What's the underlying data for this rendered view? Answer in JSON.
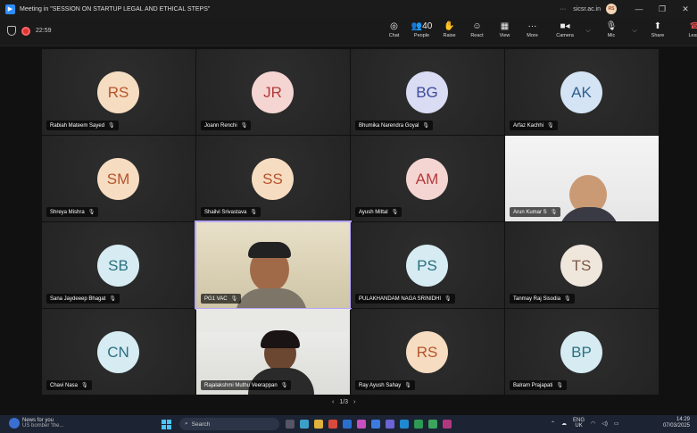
{
  "window": {
    "title": "Meeting in \"SESSION ON STARTUP LEGAL AND ETHICAL STEPS\"",
    "more": "···",
    "domain": "sicsr.ac.in",
    "user_initials": "RS",
    "minimize": "—",
    "restore": "❐",
    "close": "✕"
  },
  "toolbar": {
    "timer": "22:59",
    "items": [
      {
        "icon": "◎",
        "label": "Chat"
      },
      {
        "icon": "👥40",
        "label": "People"
      },
      {
        "icon": "✋",
        "label": "Raise"
      },
      {
        "icon": "☺",
        "label": "React"
      },
      {
        "icon": "▦",
        "label": "View"
      },
      {
        "icon": "···",
        "label": "More"
      },
      {
        "icon": "■◂",
        "label": "Camera"
      },
      {
        "icon": "🎙",
        "label": "Mic"
      },
      {
        "icon": "⬆",
        "label": "Share"
      },
      {
        "icon": "☎",
        "label": "Leave"
      }
    ],
    "chevron": "⌵"
  },
  "participants": [
    {
      "initials": "RS",
      "name": "Rabiah Mateem Sayed",
      "color": "#f6dcc0",
      "text_color": "#b5542c"
    },
    {
      "initials": "JR",
      "name": "Joann Renchi",
      "color": "#f5d5d2",
      "text_color": "#b23a3a"
    },
    {
      "initials": "BG",
      "name": "Bhumika Narendra Goyal",
      "color": "#d9dcf3",
      "text_color": "#3e4a9a"
    },
    {
      "initials": "AK",
      "name": "Arfaz Kachhi",
      "color": "#d4e4f4",
      "text_color": "#2f5f8f"
    },
    {
      "initials": "SM",
      "name": "Shreya Mishra",
      "color": "#f6dcc0",
      "text_color": "#b5542c"
    },
    {
      "initials": "SS",
      "name": "Shailvi Srivastava",
      "color": "#f6dcc0",
      "text_color": "#b5542c"
    },
    {
      "initials": "AM",
      "name": "Ayush Mittal",
      "color": "#f5d5d2",
      "text_color": "#b23a3a"
    },
    {
      "initials": "",
      "name": "Arun Kumar S",
      "video": true
    },
    {
      "initials": "SB",
      "name": "Sana Jaydeeep Bhagat",
      "color": "#d6ecf2",
      "text_color": "#2b7080"
    },
    {
      "initials": "",
      "name": "PG1 VAC",
      "video": true,
      "active": true
    },
    {
      "initials": "PS",
      "name": "PULAKHANDAM NAGA SRINIDHI",
      "color": "#d6ecf2",
      "text_color": "#2b7080"
    },
    {
      "initials": "TS",
      "name": "Tanmay Raj Sisodia",
      "color": "#efe6dc",
      "text_color": "#7a5b46"
    },
    {
      "initials": "CN",
      "name": "Chavi Nasa",
      "color": "#d6ecf2",
      "text_color": "#2b7080"
    },
    {
      "initials": "",
      "name": "Rajalakshmi Muthu Veerappan",
      "video": true
    },
    {
      "initials": "RS",
      "name": "Ray Ayush Sahay",
      "color": "#f6dcc0",
      "text_color": "#b5542c"
    },
    {
      "initials": "BP",
      "name": "Balram Prajapati",
      "color": "#d6ecf2",
      "text_color": "#2b7080"
    }
  ],
  "pager": {
    "prev": "‹",
    "page": "1/3",
    "next": "›"
  },
  "taskbar": {
    "news_title": "News for you",
    "news_sub": "US bomber 'the...",
    "search_placeholder": "Search",
    "lang_top": "ENG",
    "lang_bottom": "UK",
    "time": "14:29",
    "date": "07/03/2025"
  }
}
